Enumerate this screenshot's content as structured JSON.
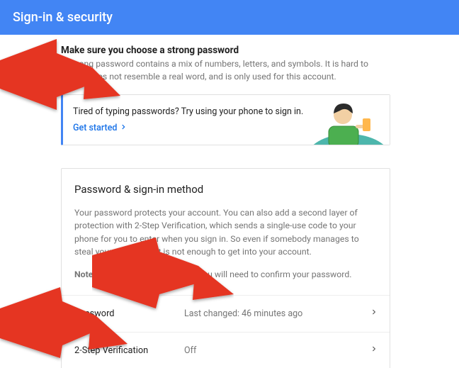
{
  "appbar": {
    "title": "Sign-in & security"
  },
  "strong": {
    "title": "Make sure you choose a strong password",
    "desc": "A strong password contains a mix of numbers, letters, and symbols. It is hard to guess, does not resemble a real word, and is only used for this account."
  },
  "phone_card": {
    "text": "Tired of typing passwords? Try using your phone to sign in.",
    "cta": "Get started"
  },
  "method": {
    "title": "Password & sign-in method",
    "desc": "Your password protects your account. You can also add a second layer of protection with 2-Step Verification, which sends a single-use code to your phone for you to enter when you sign in. So even if somebody manages to steal your password, it is not enough to get into your account.",
    "note_label": "Note:",
    "note_text": " To change these settings, you will need to confirm your password.",
    "rows": [
      {
        "label": "Password",
        "value": "Last changed: 46 minutes ago"
      },
      {
        "label": "2-Step Verification",
        "value": "Off"
      }
    ]
  },
  "colors": {
    "accent": "#4285f4",
    "link": "#1a73e8",
    "annotation": "#e53524"
  }
}
